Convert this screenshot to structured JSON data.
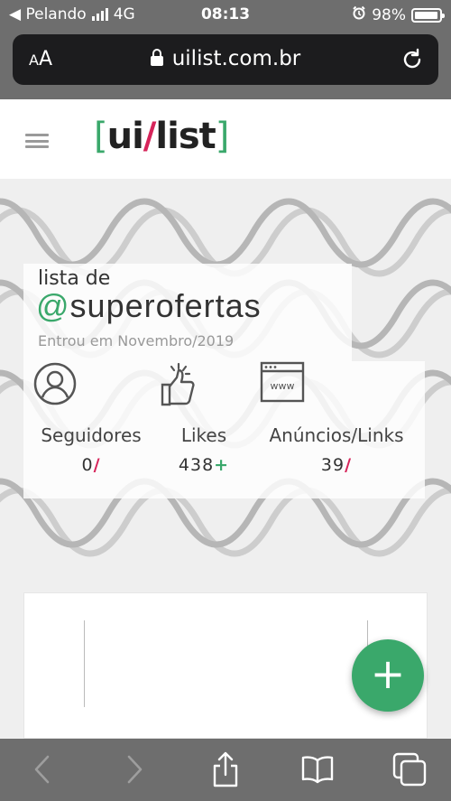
{
  "status_bar": {
    "carrier": "◀ Pelando",
    "network": "4G",
    "time": "08:13",
    "battery": "98%",
    "alarm_icon": "alarm-icon"
  },
  "safari": {
    "text_size": "AA",
    "url": "uilist.com.br",
    "reload_icon": "reload-icon",
    "lock_icon": "lock-icon"
  },
  "header": {
    "menu_icon": "hamburger-icon",
    "logo": {
      "open": "[",
      "ui": "ui",
      "slash": "/",
      "list": "list",
      "close": "]"
    }
  },
  "profile": {
    "prefix": "lista de",
    "at": "@",
    "handle": "superofertas",
    "joined": "Entrou em Novembro/2019",
    "stats": [
      {
        "icon": "user-circle-icon",
        "label": "Seguidores",
        "value": "0",
        "suffix": "/"
      },
      {
        "icon": "thumbs-up-icon",
        "label": "Likes",
        "value": "438",
        "suffix": "+"
      },
      {
        "icon": "browser-www-icon",
        "label": "Anúncios/Links",
        "value": "39",
        "suffix": "/"
      }
    ]
  },
  "fab": {
    "label": "+",
    "icon": "plus-icon"
  },
  "toolbar": {
    "items": [
      "back-icon",
      "forward-icon",
      "share-icon",
      "bookmarks-icon",
      "tabs-icon"
    ]
  },
  "colors": {
    "green": "#3aa86b",
    "magenta": "#d6245a",
    "chrome": "#6e6e6e",
    "wave": "#9c9c9c"
  },
  "www_text": "www"
}
